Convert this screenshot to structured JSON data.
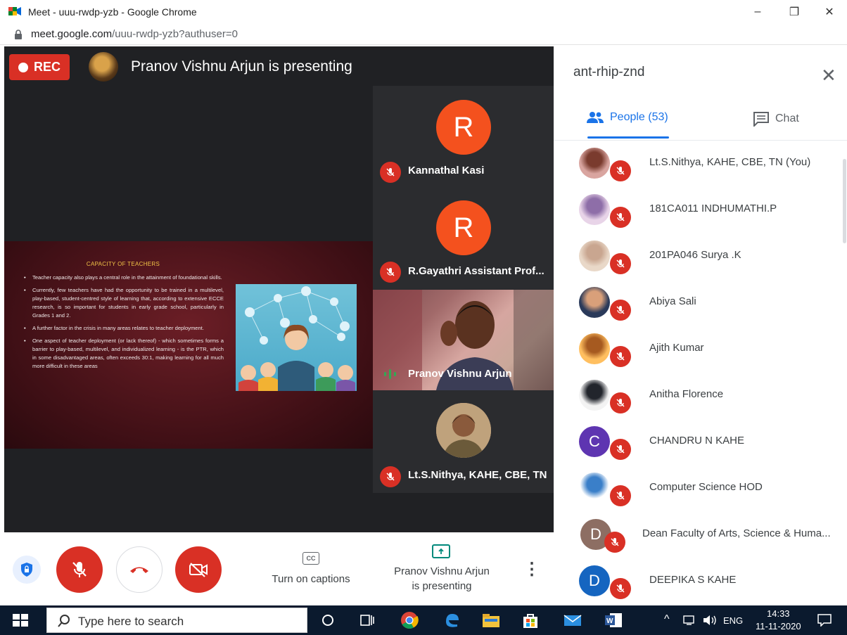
{
  "window": {
    "title": "Meet - uuu-rwdp-yzb - Google Chrome",
    "minimize": "–",
    "restore": "❐",
    "close": "✕"
  },
  "address": {
    "domain": "meet.google.com",
    "path": "/uuu-rwdp-yzb?authuser=0"
  },
  "stage": {
    "rec_label": "REC",
    "presenting_title": "Pranov Vishnu Arjun is presenting"
  },
  "slide": {
    "title": "CAPACITY OF TEACHERS",
    "bullets": [
      "Teacher capacity also plays a central role in the attainment of foundational skills.",
      "Currently, few teachers have had the opportunity to be trained in a multilevel, play-based, student-centred style of learning that, according to extensive ECCE research, is so important for students in early grade school, particularly in Grades 1 and 2.",
      "A further factor in the crisis in many areas relates to teacher deployment.",
      "One aspect of teacher deployment (or lack thereof) - which sometimes forms a barrier to play-based, multilevel, and individualized learning - is the PTR, which in some disadvantaged areas, often exceeds 30:1, making learning for all much more difficult in these areas"
    ]
  },
  "tiles": [
    {
      "initial": "R",
      "name": "Kannathal Kasi"
    },
    {
      "initial": "R",
      "name": "R.Gayathri Assistant Prof..."
    },
    {
      "name": "Pranov Vishnu Arjun"
    },
    {
      "name": "Lt.S.Nithya, KAHE, CBE, TN"
    }
  ],
  "controls": {
    "captions_icon": "CC",
    "captions_label": "Turn on captions",
    "present_line1": "Pranov Vishnu Arjun",
    "present_line2": "is presenting",
    "more": "⋮"
  },
  "panel": {
    "meeting_code": "ant-rhip-znd",
    "close": "✕",
    "people_tab": "People (53)",
    "chat_tab": "Chat",
    "accent": "#1a73e8",
    "people": [
      {
        "name": "Lt.S.Nithya, KAHE, CBE, TN (You)",
        "avatar": "photo"
      },
      {
        "name": "181CA011 INDHUMATHI.P",
        "avatar": "photo"
      },
      {
        "name": "201PA046 Surya .K",
        "avatar": "photo"
      },
      {
        "name": "Abiya Sali",
        "avatar": "photo"
      },
      {
        "name": "Ajith Kumar",
        "avatar": "photo"
      },
      {
        "name": "Anitha Florence",
        "avatar": "photo"
      },
      {
        "name": "CHANDRU N KAHE",
        "avatar": "C"
      },
      {
        "name": "Computer Science HOD",
        "avatar": "photo"
      },
      {
        "name": "Dean Faculty of Arts, Science & Huma...",
        "avatar": "D"
      },
      {
        "name": "DEEPIKA S KAHE",
        "avatar": "D"
      }
    ]
  },
  "taskbar": {
    "search_placeholder": "Type here to search",
    "language": "ENG",
    "time": "14:33",
    "date": "11-11-2020"
  }
}
